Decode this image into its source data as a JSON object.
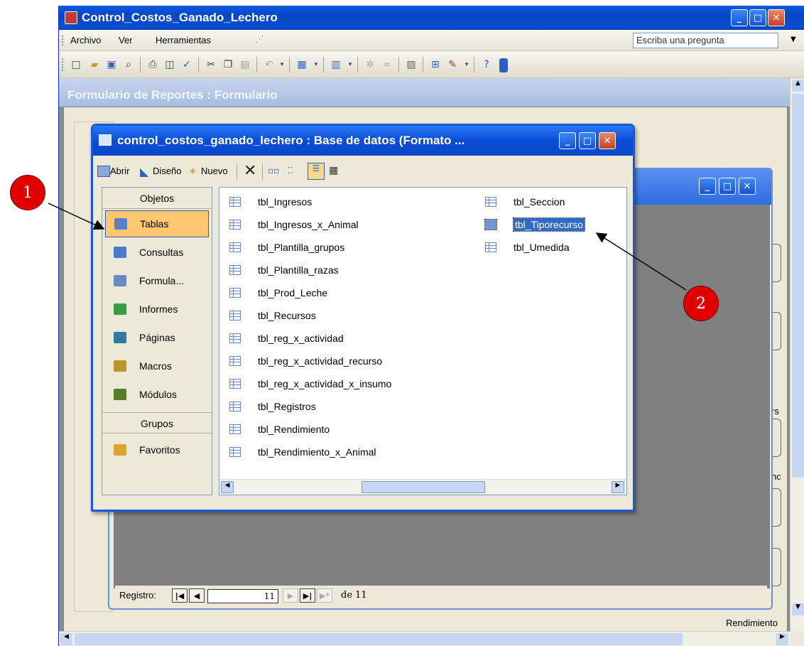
{
  "app": {
    "title": "Control_Costos_Ganado_Lechero",
    "menu": [
      "Archivo",
      "Ver",
      "Herramientas"
    ],
    "help_placeholder": "Escriba una pregunta"
  },
  "form": {
    "title": "Formulario  de  Reportes : Formulario",
    "nav_label": "Registro:",
    "current_record": "11",
    "of_label": "de 11",
    "side_fragments": [
      "rs",
      "nc"
    ],
    "bottom_label": "Rendimiento"
  },
  "dbwin": {
    "title": "control_costos_ganado_lechero : Base de datos (Formato ...",
    "toolbar": {
      "open": "Abrir",
      "design": "Diseño",
      "new": "Nuevo"
    },
    "objects_header": "Objetos",
    "objects": [
      {
        "label": "Tablas",
        "icon": "table-icon",
        "color": "#5b7fc9"
      },
      {
        "label": "Consultas",
        "icon": "query-icon",
        "color": "#4a7ac8"
      },
      {
        "label": "Formula...",
        "icon": "form-icon",
        "color": "#6a88c4"
      },
      {
        "label": "Informes",
        "icon": "report-icon",
        "color": "#3d9a4a"
      },
      {
        "label": "Páginas",
        "icon": "page-icon",
        "color": "#2f7a9e"
      },
      {
        "label": "Macros",
        "icon": "macro-icon",
        "color": "#b8962e"
      },
      {
        "label": "Módulos",
        "icon": "module-icon",
        "color": "#5a7a2e"
      }
    ],
    "groups_header": "Grupos",
    "groups": [
      {
        "label": "Favoritos",
        "icon": "favorites-icon",
        "color": "#d9a430"
      }
    ],
    "tables_col1": [
      "tbl_Ingresos",
      "tbl_Ingresos_x_Animal",
      "tbl_Plantilla_grupos",
      "tbl_Plantilla_razas",
      "tbl_Prod_Leche",
      "tbl_Recursos",
      "tbl_reg_x_actividad",
      "tbl_reg_x_actividad_recurso",
      "tbl_reg_x_actividad_x_insumo",
      "tbl_Registros",
      "tbl_Rendimiento",
      "tbl_Rendimiento_x_Animal"
    ],
    "tables_col2": [
      "tbl_Seccion",
      "tbl_Tiporecurso",
      "tbl_Umedida"
    ]
  },
  "callouts": [
    "1",
    "2"
  ]
}
